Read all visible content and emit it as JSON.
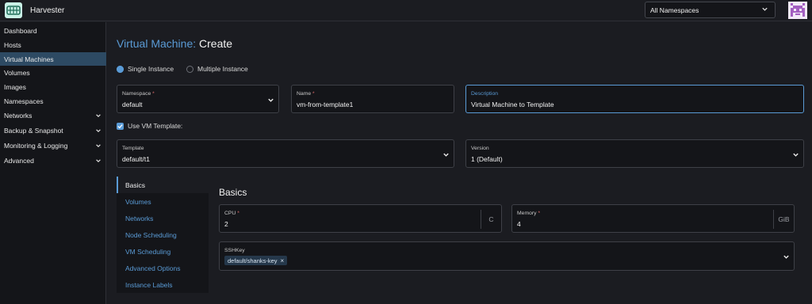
{
  "header": {
    "app_title": "Harvester",
    "namespace_select": "All Namespaces"
  },
  "sidebar": {
    "items": [
      {
        "label": "Dashboard"
      },
      {
        "label": "Hosts"
      },
      {
        "label": "Virtual Machines",
        "active": true
      },
      {
        "label": "Volumes"
      },
      {
        "label": "Images"
      },
      {
        "label": "Namespaces"
      },
      {
        "label": "Networks",
        "expandable": true
      },
      {
        "label": "Backup & Snapshot",
        "expandable": true
      },
      {
        "label": "Monitoring & Logging",
        "expandable": true
      },
      {
        "label": "Advanced",
        "expandable": true
      }
    ]
  },
  "page": {
    "breadcrumb": "Virtual Machine:",
    "action": "Create"
  },
  "instance_mode": {
    "single": "Single Instance",
    "multiple": "Multiple Instance",
    "selected": "single"
  },
  "form": {
    "namespace": {
      "label": "Namespace",
      "required": true,
      "value": "default"
    },
    "name": {
      "label": "Name",
      "required": true,
      "value": "vm-from-template1"
    },
    "description": {
      "label": "Description",
      "value": "Virtual Machine to Template"
    },
    "use_template": {
      "label": "Use VM Template:",
      "checked": true
    },
    "template": {
      "label": "Template",
      "value": "default/t1"
    },
    "version": {
      "label": "Version",
      "value": "1 (Default)"
    }
  },
  "tabs": [
    {
      "label": "Basics",
      "active": true
    },
    {
      "label": "Volumes"
    },
    {
      "label": "Networks"
    },
    {
      "label": "Node Scheduling"
    },
    {
      "label": "VM Scheduling"
    },
    {
      "label": "Advanced Options"
    },
    {
      "label": "Instance Labels"
    }
  ],
  "basics": {
    "title": "Basics",
    "cpu": {
      "label": "CPU",
      "required": true,
      "value": "2",
      "unit": "C"
    },
    "memory": {
      "label": "Memory",
      "required": true,
      "value": "4",
      "unit": "GiB"
    },
    "sshkey": {
      "label": "SSHKey",
      "chips": [
        "default/shanks-key"
      ]
    }
  },
  "colors": {
    "accent": "#5a9bd6",
    "background": "#1b1c21",
    "sidebar_active": "#2d4a63",
    "required": "#e06b6b"
  },
  "icons": {
    "logo": "harvester-logo-icon",
    "avatar": "user-avatar-icon",
    "dropdown": "chevron-down-icon",
    "remove": "close-icon"
  }
}
